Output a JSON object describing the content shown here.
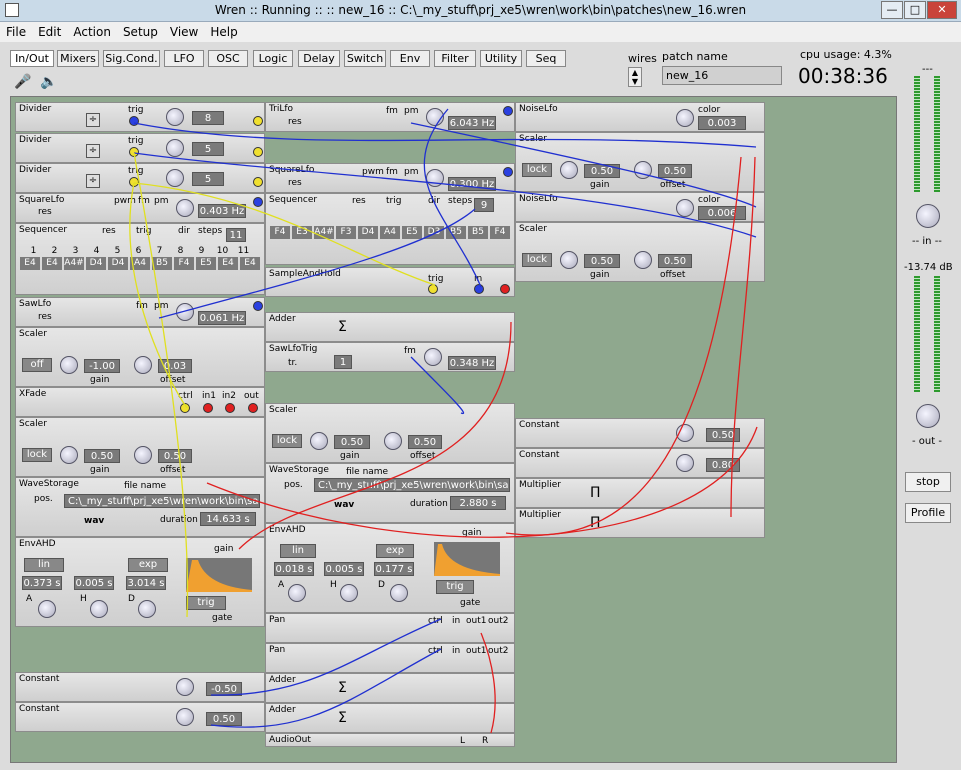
{
  "window": {
    "title": "Wren :: Running :: :: new_16 :: C:\\_my_stuff\\prj_xe5\\wren\\work\\bin\\patches\\new_16.wren"
  },
  "menu": [
    "File",
    "Edit",
    "Action",
    "Setup",
    "View",
    "Help"
  ],
  "tabs": [
    "In/Out",
    "Mixers",
    "Sig.Cond.",
    "LFO",
    "OSC",
    "Logic",
    "Delay",
    "Switch",
    "Env",
    "Filter",
    "Utility",
    "Seq"
  ],
  "wires_label": "wires",
  "patch": {
    "label": "patch name",
    "value": "new_16"
  },
  "cpu": "cpu usage: 4.3%",
  "clock": "00:38:36",
  "right": {
    "top": "---",
    "in": "-- in --",
    "db": "-13.74 dB",
    "out": "- out -",
    "stop": "stop",
    "profile": "Profile"
  },
  "labels": {
    "trig": "trig",
    "res": "res",
    "fm": "fm",
    "pm": "pm",
    "pwm": "pwm",
    "dir": "dir",
    "steps": "steps",
    "gain": "gain",
    "offset": "offset",
    "ctrl": "ctrl",
    "in": "in",
    "in1": "in1",
    "in2": "in2",
    "out": "out",
    "out1": "out1",
    "out2": "out2",
    "color": "color",
    "lock": "lock",
    "off": "off",
    "lin": "lin",
    "exp": "exp",
    "wav": "wav",
    "duration": "duration",
    "file_name": "file name",
    "pos": "pos.",
    "gate": "gate",
    "tr": "tr.",
    "A": "A",
    "H": "H",
    "D": "D",
    "L": "L",
    "R": "R"
  },
  "modules": [
    {
      "title": "Divider",
      "value": "8"
    },
    {
      "title": "Divider",
      "value": "5"
    },
    {
      "title": "Divider",
      "value": "5"
    },
    {
      "title": "SquareLfo",
      "value": "0.403 Hz"
    },
    {
      "title": "Sequencer",
      "value": "11"
    },
    {
      "title": "SawLfo",
      "value": "0.061 Hz"
    },
    {
      "title": "Scaler",
      "v1": "-1.00",
      "v2": "0.03"
    },
    {
      "title": "XFade"
    },
    {
      "title": "Scaler",
      "v1": "0.50",
      "v2": "0.50"
    },
    {
      "title": "WaveStorage",
      "file": "C:\\_my_stuff\\prj_xe5\\wren\\work\\bin\\sa",
      "duration": "14.633 s"
    },
    {
      "title": "EnvAHD",
      "a": "0.373 s",
      "h": "0.005 s",
      "d": "3.014 s"
    },
    {
      "title": "Constant",
      "value": "-0.50"
    },
    {
      "title": "Constant",
      "value": "0.50"
    },
    {
      "title": "TriLfo",
      "value": "6.043 Hz"
    },
    {
      "title": "SquareLfo",
      "value": "0.300 Hz"
    },
    {
      "title": "Sequencer",
      "value": "9"
    },
    {
      "title": "SampleAndHold"
    },
    {
      "title": "Adder"
    },
    {
      "title": "SawLfoTrig",
      "value": "0.348 Hz",
      "steps": "1"
    },
    {
      "title": "Scaler",
      "v1": "0.50",
      "v2": "0.50"
    },
    {
      "title": "WaveStorage",
      "file": "C:\\_my_stuff\\prj_xe5\\wren\\work\\bin\\sa",
      "duration": "2.880 s"
    },
    {
      "title": "EnvAHD",
      "a": "0.018 s",
      "h": "0.005 s",
      "d": "0.177 s"
    },
    {
      "title": "Pan"
    },
    {
      "title": "Pan"
    },
    {
      "title": "Adder"
    },
    {
      "title": "Adder"
    },
    {
      "title": "AudioOut"
    },
    {
      "title": "NoiseLfo",
      "value": "0.003"
    },
    {
      "title": "Scaler",
      "v1": "0.50",
      "v2": "0.50"
    },
    {
      "title": "NoiseLfo",
      "value": "0.006"
    },
    {
      "title": "Scaler",
      "v1": "0.50",
      "v2": "0.50"
    },
    {
      "title": "Constant",
      "value": "0.50"
    },
    {
      "title": "Constant",
      "value": "0.80"
    },
    {
      "title": "Multiplier"
    },
    {
      "title": "Multiplier"
    }
  ],
  "seq1": {
    "nums": [
      "1",
      "2",
      "3",
      "4",
      "5",
      "6",
      "7",
      "8",
      "9",
      "10",
      "11"
    ],
    "notes": [
      "E4",
      "E4",
      "A4#",
      "D4",
      "D4",
      "A4",
      "B5",
      "F4",
      "E5",
      "E4",
      "E4"
    ]
  },
  "seq2": {
    "notes": [
      "F4",
      "E3",
      "A4#",
      "F3",
      "D4",
      "A4",
      "E5",
      "D3",
      "B5",
      "B5",
      "F4"
    ]
  }
}
